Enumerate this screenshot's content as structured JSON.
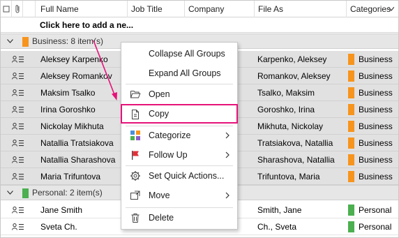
{
  "header": {
    "columns": [
      "Full Name",
      "Job Title",
      "Company",
      "File As",
      "Categories"
    ]
  },
  "add_row": {
    "text": "Click here to add a ne..."
  },
  "groups": [
    {
      "label": "Business: 8 item(s)",
      "color": "#f7941d"
    },
    {
      "label": "Personal: 2 item(s)",
      "color": "#4caf50"
    }
  ],
  "business_rows": [
    {
      "name": "Aleksey Karpenko",
      "file_as": "Karpenko, Aleksey",
      "category": "Business"
    },
    {
      "name": "Aleksey Romankov",
      "file_as": "Romankov, Aleksey",
      "category": "Business"
    },
    {
      "name": "Maksim Tsalko",
      "file_as": "Tsalko, Maksim",
      "category": "Business"
    },
    {
      "name": "Irina Goroshko",
      "file_as": "Goroshko, Irina",
      "category": "Business"
    },
    {
      "name": "Nickolay Mikhuta",
      "file_as": "Mikhuta, Nickolay",
      "category": "Business"
    },
    {
      "name": "Natallia Tratsiakova",
      "file_as": "Tratsiakova, Natallia",
      "category": "Business"
    },
    {
      "name": "Natallia Sharashova",
      "file_as": "Sharashova, Natallia",
      "category": "Business"
    },
    {
      "name": "Maria Trifuntova",
      "file_as": "Trifuntova, Maria",
      "category": "Business"
    }
  ],
  "personal_rows": [
    {
      "name": "Jane Smith",
      "file_as": "Smith, Jane",
      "category": "Personal"
    },
    {
      "name": "Sveta Ch.",
      "file_as": "Ch., Sveta",
      "category": "Personal"
    }
  ],
  "menu": {
    "collapse": "Collapse All Groups",
    "expand": "Expand All Groups",
    "open": "Open",
    "copy": "Copy",
    "categorize": "Categorize",
    "follow_up": "Follow Up",
    "quick_actions": "Set Quick Actions...",
    "move": "Move",
    "delete": "Delete"
  },
  "colors": {
    "business": "#f7941d",
    "personal": "#4caf50",
    "highlight": "#e6127a"
  }
}
